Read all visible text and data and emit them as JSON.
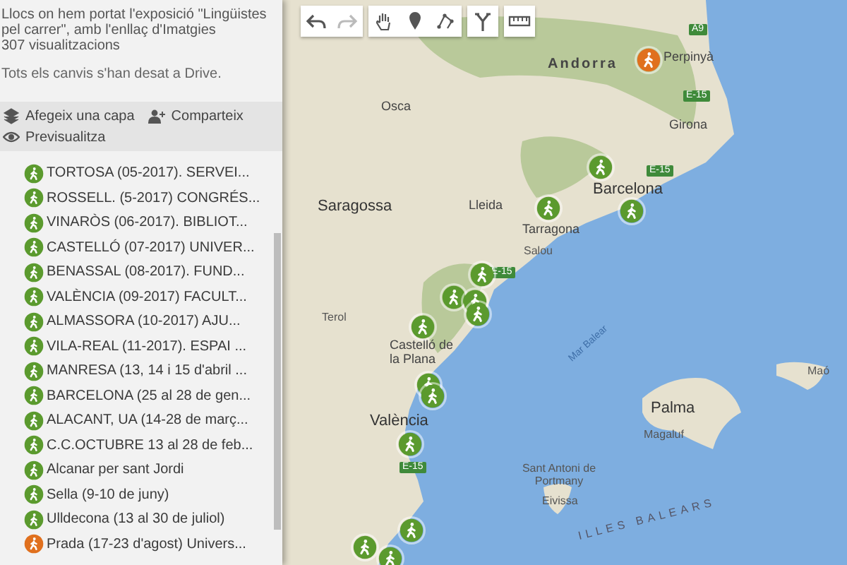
{
  "panel": {
    "description": "Llocs on hem portat l'exposició \"Lingüistes pel carrer\", amb l'enllaç d'Imatgies",
    "views": "307 visualitzacions",
    "save_status": "Tots els canvis s'han desat a Drive.",
    "actions": [
      {
        "kind": "layer",
        "label": "Afegeix una capa"
      },
      {
        "kind": "share",
        "label": "Comparteix"
      },
      {
        "kind": "preview",
        "label": "Previsualitza"
      }
    ],
    "items": [
      {
        "label": "TORTOSA (05-2017). SERVEI...",
        "color": "#5b9a2e"
      },
      {
        "label": "ROSSELL. (5-2017) CONGRÉS...",
        "color": "#5b9a2e"
      },
      {
        "label": "VINARÒS (06-2017). BIBLIOT...",
        "color": "#5b9a2e"
      },
      {
        "label": "CASTELLÓ (07-2017) UNIVER...",
        "color": "#5b9a2e"
      },
      {
        "label": "BENASSAL (08-2017). FUND...",
        "color": "#5b9a2e"
      },
      {
        "label": "VALÈNCIA (09-2017) FACULT...",
        "color": "#5b9a2e"
      },
      {
        "label": "ALMASSORA (10-2017) AJU...",
        "color": "#5b9a2e"
      },
      {
        "label": "VILA-REAL (11-2017). ESPAI ...",
        "color": "#5b9a2e"
      },
      {
        "label": "MANRESA (13, 14 i 15 d'abril ...",
        "color": "#5b9a2e"
      },
      {
        "label": "BARCELONA (25 al 28 de gen...",
        "color": "#5b9a2e"
      },
      {
        "label": "ALACANT, UA (14-28 de març...",
        "color": "#5b9a2e"
      },
      {
        "label": "C.C.OCTUBRE 13 al 28 de feb...",
        "color": "#5b9a2e"
      },
      {
        "label": "Alcanar per sant Jordi",
        "color": "#5b9a2e"
      },
      {
        "label": "Sella (9-10 de juny)",
        "color": "#5b9a2e"
      },
      {
        "label": "Ulldecona (13 al 30 de juliol)",
        "color": "#5b9a2e"
      },
      {
        "label": "Prada (17-23 d'agost) Univers...",
        "color": "#e0701e"
      }
    ]
  },
  "toolbar": [
    {
      "kind": "undo",
      "disabled": false
    },
    {
      "kind": "redo",
      "disabled": true
    },
    {
      "kind": "hand",
      "disabled": false
    },
    {
      "kind": "marker",
      "disabled": false
    },
    {
      "kind": "line",
      "disabled": false
    },
    {
      "kind": "route",
      "disabled": false
    },
    {
      "kind": "ruler",
      "disabled": false
    }
  ],
  "map": {
    "labels": [
      {
        "kind": "town",
        "text": "Osca"
      },
      {
        "kind": "city",
        "text": "Saragossa"
      },
      {
        "kind": "town",
        "text": "Lleida"
      },
      {
        "kind": "country",
        "text": "Andorra"
      },
      {
        "kind": "town",
        "text": "Perpinyà"
      },
      {
        "kind": "town",
        "text": "Girona"
      },
      {
        "kind": "city",
        "text": "Barcelona"
      },
      {
        "kind": "town",
        "text": "Tarragona"
      },
      {
        "kind": "small",
        "text": "Salou"
      },
      {
        "kind": "small",
        "text": "Terol"
      },
      {
        "kind": "town",
        "text": "Castelló de la Plana"
      },
      {
        "kind": "city",
        "text": "València"
      },
      {
        "kind": "sea",
        "text": "Mar Balear"
      },
      {
        "kind": "city",
        "text": "Palma"
      },
      {
        "kind": "small",
        "text": "Magaluf"
      },
      {
        "kind": "small",
        "text": "Maó"
      },
      {
        "kind": "small",
        "text": "Sant Antoni de Portmany"
      },
      {
        "kind": "small",
        "text": "Eivissa"
      },
      {
        "kind": "islands",
        "text": "ILLES BALEARS"
      },
      {
        "kind": "road",
        "text": "A9"
      },
      {
        "kind": "road",
        "text": "E-15"
      },
      {
        "kind": "road",
        "text": "E-15"
      },
      {
        "kind": "road",
        "text": "E-15"
      },
      {
        "kind": "road",
        "text": "E-15"
      }
    ],
    "markers": [
      {
        "color": "#e0701e"
      },
      {
        "color": "#5b9a2e"
      },
      {
        "color": "#5b9a2e"
      },
      {
        "color": "#5b9a2e"
      },
      {
        "color": "#5b9a2e"
      },
      {
        "color": "#5b9a2e"
      },
      {
        "color": "#5b9a2e"
      },
      {
        "color": "#5b9a2e"
      },
      {
        "color": "#5b9a2e"
      },
      {
        "color": "#5b9a2e"
      },
      {
        "color": "#5b9a2e"
      },
      {
        "color": "#5b9a2e"
      },
      {
        "color": "#5b9a2e"
      },
      {
        "color": "#5b9a2e"
      },
      {
        "color": "#5b9a2e"
      }
    ]
  }
}
